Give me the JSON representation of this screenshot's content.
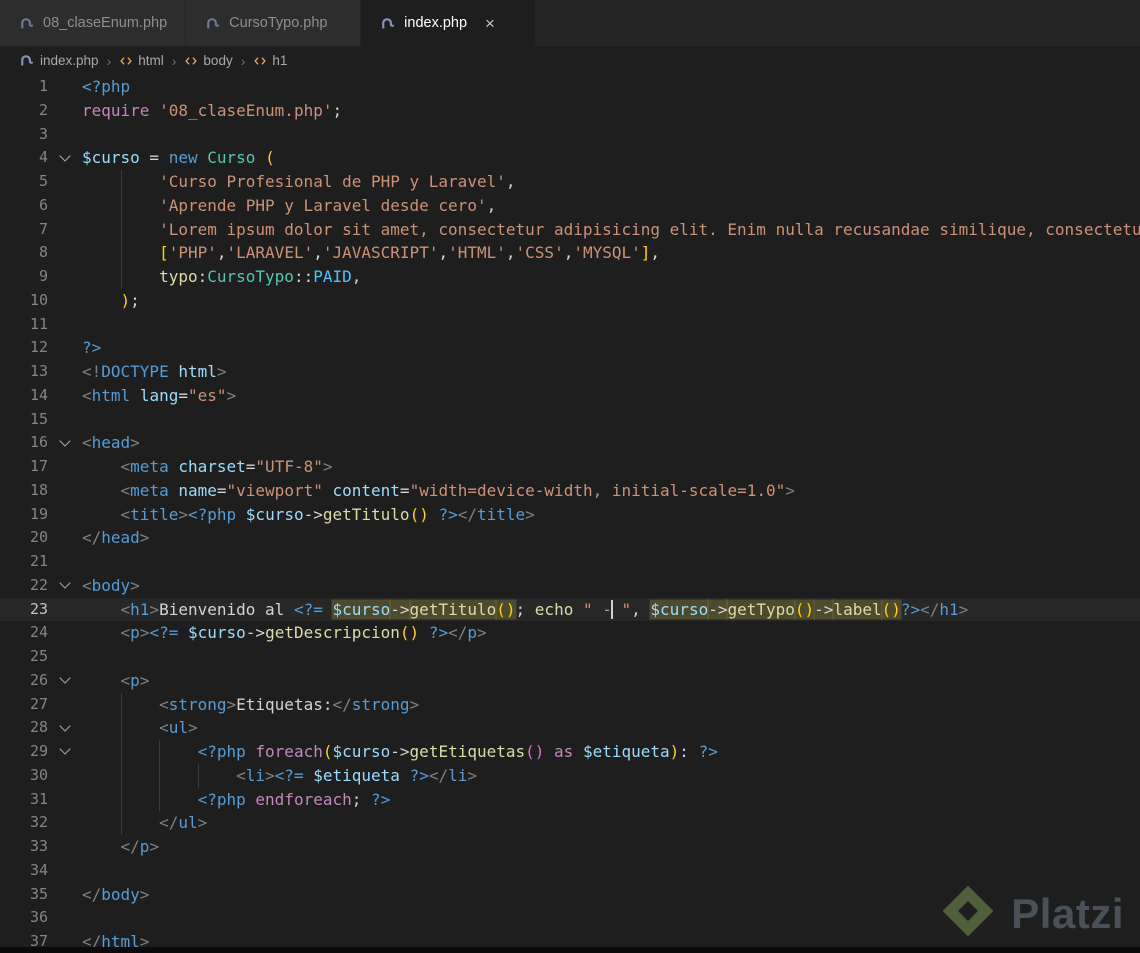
{
  "palette": {
    "kw": "#C586C0",
    "kw2": "#569CD6",
    "var": "#9CDCFE",
    "str": "#CE9178",
    "fn": "#DCDCAA",
    "cls": "#4EC9B0",
    "tag": "#569CD6",
    "tagp": "#808080",
    "attr": "#9CDCFE",
    "punc": "#D4D4D4",
    "txt": "#D4D4D4",
    "b1": "#FFD700",
    "b2": "#DA70D6",
    "const": "#4FC1FF"
  },
  "tabs": [
    {
      "label": "08_claseEnum.php",
      "active": false
    },
    {
      "label": "CursoTypo.php",
      "active": false
    },
    {
      "label": "index.php",
      "active": true,
      "close": "×"
    }
  ],
  "breadcrumb": {
    "file": "index.php",
    "separator": "›",
    "path": [
      "html",
      "body",
      "h1"
    ]
  },
  "watermark": {
    "label": "Platzi"
  },
  "editor": {
    "active_line": 23,
    "lines": [
      {
        "n": 1,
        "ind": 0,
        "toks": [
          [
            "kw2",
            "<?php"
          ]
        ]
      },
      {
        "n": 2,
        "ind": 0,
        "toks": [
          [
            "kw",
            "require"
          ],
          [
            "punc",
            " "
          ],
          [
            "str",
            "'08_claseEnum.php'"
          ],
          [
            "punc",
            ";"
          ]
        ]
      },
      {
        "n": 3,
        "ind": 0,
        "toks": []
      },
      {
        "n": 4,
        "ind": 0,
        "fold": true,
        "toks": [
          [
            "var",
            "$curso"
          ],
          [
            "punc",
            " = "
          ],
          [
            "kw2",
            "new"
          ],
          [
            "punc",
            " "
          ],
          [
            "cls",
            "Curso"
          ],
          [
            "punc",
            " "
          ],
          [
            "b1",
            "("
          ]
        ]
      },
      {
        "n": 5,
        "ind": 8,
        "toks": [
          [
            "str",
            "'Curso Profesional de PHP y Laravel'"
          ],
          [
            "punc",
            ","
          ]
        ]
      },
      {
        "n": 6,
        "ind": 8,
        "toks": [
          [
            "str",
            "'Aprende PHP y Laravel desde cero'"
          ],
          [
            "punc",
            ","
          ]
        ]
      },
      {
        "n": 7,
        "ind": 8,
        "toks": [
          [
            "str",
            "'Lorem ipsum dolor sit amet, consectetur adipisicing elit. Enim nulla recusandae similique, consectetur quisquam.'"
          ],
          [
            "punc",
            ","
          ]
        ]
      },
      {
        "n": 8,
        "ind": 8,
        "toks": [
          [
            "b1",
            "["
          ],
          [
            "str",
            "'PHP'"
          ],
          [
            "punc",
            ","
          ],
          [
            "str",
            "'LARAVEL'"
          ],
          [
            "punc",
            ","
          ],
          [
            "str",
            "'JAVASCRIPT'"
          ],
          [
            "punc",
            ","
          ],
          [
            "str",
            "'HTML'"
          ],
          [
            "punc",
            ","
          ],
          [
            "str",
            "'CSS'"
          ],
          [
            "punc",
            ","
          ],
          [
            "str",
            "'MYSQL'"
          ],
          [
            "b1",
            "]"
          ],
          [
            "punc",
            ","
          ]
        ]
      },
      {
        "n": 9,
        "ind": 8,
        "toks": [
          [
            "fn",
            "typo"
          ],
          [
            "punc",
            ":"
          ],
          [
            "cls",
            "CursoTypo"
          ],
          [
            "punc",
            "::"
          ],
          [
            "const",
            "PAID"
          ],
          [
            "punc",
            ","
          ]
        ]
      },
      {
        "n": 10,
        "ind": 4,
        "toks": [
          [
            "b1",
            ")"
          ],
          [
            "punc",
            ";"
          ]
        ]
      },
      {
        "n": 11,
        "ind": 0,
        "toks": []
      },
      {
        "n": 12,
        "ind": 0,
        "toks": [
          [
            "kw2",
            "?>"
          ]
        ]
      },
      {
        "n": 13,
        "ind": 0,
        "toks": [
          [
            "tagp",
            "<!"
          ],
          [
            "tag",
            "DOCTYPE"
          ],
          [
            "punc",
            " "
          ],
          [
            "attr",
            "html"
          ],
          [
            "tagp",
            ">"
          ]
        ]
      },
      {
        "n": 14,
        "ind": 0,
        "toks": [
          [
            "tagp",
            "<"
          ],
          [
            "tag",
            "html"
          ],
          [
            "punc",
            " "
          ],
          [
            "attr",
            "lang"
          ],
          [
            "punc",
            "="
          ],
          [
            "str",
            "\"es\""
          ],
          [
            "tagp",
            ">"
          ]
        ]
      },
      {
        "n": 15,
        "ind": 0,
        "toks": []
      },
      {
        "n": 16,
        "ind": 0,
        "fold": true,
        "toks": [
          [
            "tagp",
            "<"
          ],
          [
            "tag",
            "head"
          ],
          [
            "tagp",
            ">"
          ]
        ]
      },
      {
        "n": 17,
        "ind": 4,
        "toks": [
          [
            "tagp",
            "<"
          ],
          [
            "tag",
            "meta"
          ],
          [
            "punc",
            " "
          ],
          [
            "attr",
            "charset"
          ],
          [
            "punc",
            "="
          ],
          [
            "str",
            "\"UTF-8\""
          ],
          [
            "tagp",
            ">"
          ]
        ]
      },
      {
        "n": 18,
        "ind": 4,
        "toks": [
          [
            "tagp",
            "<"
          ],
          [
            "tag",
            "meta"
          ],
          [
            "punc",
            " "
          ],
          [
            "attr",
            "name"
          ],
          [
            "punc",
            "="
          ],
          [
            "str",
            "\"viewport\""
          ],
          [
            "punc",
            " "
          ],
          [
            "attr",
            "content"
          ],
          [
            "punc",
            "="
          ],
          [
            "str",
            "\"width=device-width, initial-scale=1.0\""
          ],
          [
            "tagp",
            ">"
          ]
        ]
      },
      {
        "n": 19,
        "ind": 4,
        "toks": [
          [
            "tagp",
            "<"
          ],
          [
            "tag",
            "title"
          ],
          [
            "tagp",
            ">"
          ],
          [
            "kw2",
            "<?php"
          ],
          [
            "punc",
            " "
          ],
          [
            "var",
            "$curso"
          ],
          [
            "punc",
            "->"
          ],
          [
            "fn",
            "getTitulo"
          ],
          [
            "b1",
            "()"
          ],
          [
            "punc",
            " "
          ],
          [
            "kw2",
            "?>"
          ],
          [
            "tagp",
            "</"
          ],
          [
            "tag",
            "title"
          ],
          [
            "tagp",
            ">"
          ]
        ]
      },
      {
        "n": 20,
        "ind": 0,
        "toks": [
          [
            "tagp",
            "</"
          ],
          [
            "tag",
            "head"
          ],
          [
            "tagp",
            ">"
          ]
        ]
      },
      {
        "n": 21,
        "ind": 0,
        "toks": []
      },
      {
        "n": 22,
        "ind": 0,
        "fold": true,
        "toks": [
          [
            "tagp",
            "<"
          ],
          [
            "tag",
            "body"
          ],
          [
            "tagp",
            ">"
          ]
        ]
      },
      {
        "n": 23,
        "ind": 4,
        "cur": true,
        "toks": [
          [
            "tagp",
            "<"
          ],
          [
            "tag",
            "h1"
          ],
          [
            "tagp",
            ">"
          ],
          [
            "txt",
            "Bienvenido al "
          ],
          [
            "kw2",
            "<?="
          ],
          [
            "punc",
            " "
          ],
          [
            "var hl",
            "$curso"
          ],
          [
            "punc hl",
            "->"
          ],
          [
            "fn hl",
            "getTitulo"
          ],
          [
            "b1 hl",
            "()"
          ],
          [
            "punc",
            ";"
          ],
          [
            "punc",
            " "
          ],
          [
            "fn",
            "echo"
          ],
          [
            "punc",
            " "
          ],
          [
            "str",
            "\" -"
          ],
          [
            "caret",
            ""
          ],
          [
            "str",
            " \""
          ],
          [
            "punc",
            ", "
          ],
          [
            "var hl",
            "$curso"
          ],
          [
            "punc hl",
            "->"
          ],
          [
            "fn hl",
            "getTypo"
          ],
          [
            "b1 hl",
            "()"
          ],
          [
            "punc hl",
            "->"
          ],
          [
            "fn hl",
            "label"
          ],
          [
            "b1 hl",
            "()"
          ],
          [
            "kw2",
            "?>"
          ],
          [
            "tagp",
            "</"
          ],
          [
            "tag",
            "h1"
          ],
          [
            "tagp",
            ">"
          ]
        ]
      },
      {
        "n": 24,
        "ind": 4,
        "toks": [
          [
            "tagp",
            "<"
          ],
          [
            "tag",
            "p"
          ],
          [
            "tagp",
            ">"
          ],
          [
            "kw2",
            "<?="
          ],
          [
            "punc",
            " "
          ],
          [
            "var",
            "$curso"
          ],
          [
            "punc",
            "->"
          ],
          [
            "fn",
            "getDescripcion"
          ],
          [
            "b1",
            "()"
          ],
          [
            "punc",
            " "
          ],
          [
            "kw2",
            "?>"
          ],
          [
            "tagp",
            "</"
          ],
          [
            "tag",
            "p"
          ],
          [
            "tagp",
            ">"
          ]
        ]
      },
      {
        "n": 25,
        "ind": 0,
        "toks": []
      },
      {
        "n": 26,
        "ind": 4,
        "fold": true,
        "toks": [
          [
            "tagp",
            "<"
          ],
          [
            "tag",
            "p"
          ],
          [
            "tagp",
            ">"
          ]
        ]
      },
      {
        "n": 27,
        "ind": 8,
        "toks": [
          [
            "tagp",
            "<"
          ],
          [
            "tag",
            "strong"
          ],
          [
            "tagp",
            ">"
          ],
          [
            "txt",
            "Etiquetas:"
          ],
          [
            "tagp",
            "</"
          ],
          [
            "tag",
            "strong"
          ],
          [
            "tagp",
            ">"
          ]
        ]
      },
      {
        "n": 28,
        "ind": 8,
        "fold": true,
        "toks": [
          [
            "tagp",
            "<"
          ],
          [
            "tag",
            "ul"
          ],
          [
            "tagp",
            ">"
          ]
        ]
      },
      {
        "n": 29,
        "ind": 12,
        "fold": true,
        "toks": [
          [
            "kw2",
            "<?php"
          ],
          [
            "punc",
            " "
          ],
          [
            "kw",
            "foreach"
          ],
          [
            "b1",
            "("
          ],
          [
            "var",
            "$curso"
          ],
          [
            "punc",
            "->"
          ],
          [
            "fn",
            "getEtiquetas"
          ],
          [
            "b2",
            "()"
          ],
          [
            "punc",
            " "
          ],
          [
            "kw",
            "as"
          ],
          [
            "punc",
            " "
          ],
          [
            "var",
            "$etiqueta"
          ],
          [
            "b1",
            ")"
          ],
          [
            "punc",
            ":"
          ],
          [
            "punc",
            " "
          ],
          [
            "kw2",
            "?>"
          ]
        ]
      },
      {
        "n": 30,
        "ind": 16,
        "toks": [
          [
            "tagp",
            "<"
          ],
          [
            "tag",
            "li"
          ],
          [
            "tagp",
            ">"
          ],
          [
            "kw2",
            "<?="
          ],
          [
            "punc",
            " "
          ],
          [
            "var",
            "$etiqueta"
          ],
          [
            "punc",
            " "
          ],
          [
            "kw2",
            "?>"
          ],
          [
            "tagp",
            "</"
          ],
          [
            "tag",
            "li"
          ],
          [
            "tagp",
            ">"
          ]
        ]
      },
      {
        "n": 31,
        "ind": 12,
        "toks": [
          [
            "kw2",
            "<?php"
          ],
          [
            "punc",
            " "
          ],
          [
            "kw",
            "endforeach"
          ],
          [
            "punc",
            ";"
          ],
          [
            "punc",
            " "
          ],
          [
            "kw2",
            "?>"
          ]
        ]
      },
      {
        "n": 32,
        "ind": 8,
        "toks": [
          [
            "tagp",
            "</"
          ],
          [
            "tag",
            "ul"
          ],
          [
            "tagp",
            ">"
          ]
        ]
      },
      {
        "n": 33,
        "ind": 4,
        "toks": [
          [
            "tagp",
            "</"
          ],
          [
            "tag",
            "p"
          ],
          [
            "tagp",
            ">"
          ]
        ]
      },
      {
        "n": 34,
        "ind": 0,
        "toks": []
      },
      {
        "n": 35,
        "ind": 0,
        "toks": [
          [
            "tagp",
            "</"
          ],
          [
            "tag",
            "body"
          ],
          [
            "tagp",
            ">"
          ]
        ]
      },
      {
        "n": 36,
        "ind": 0,
        "toks": []
      },
      {
        "n": 37,
        "ind": 0,
        "toks": [
          [
            "tagp",
            "</"
          ],
          [
            "tag",
            "html"
          ],
          [
            "tagp",
            ">"
          ]
        ]
      }
    ]
  }
}
